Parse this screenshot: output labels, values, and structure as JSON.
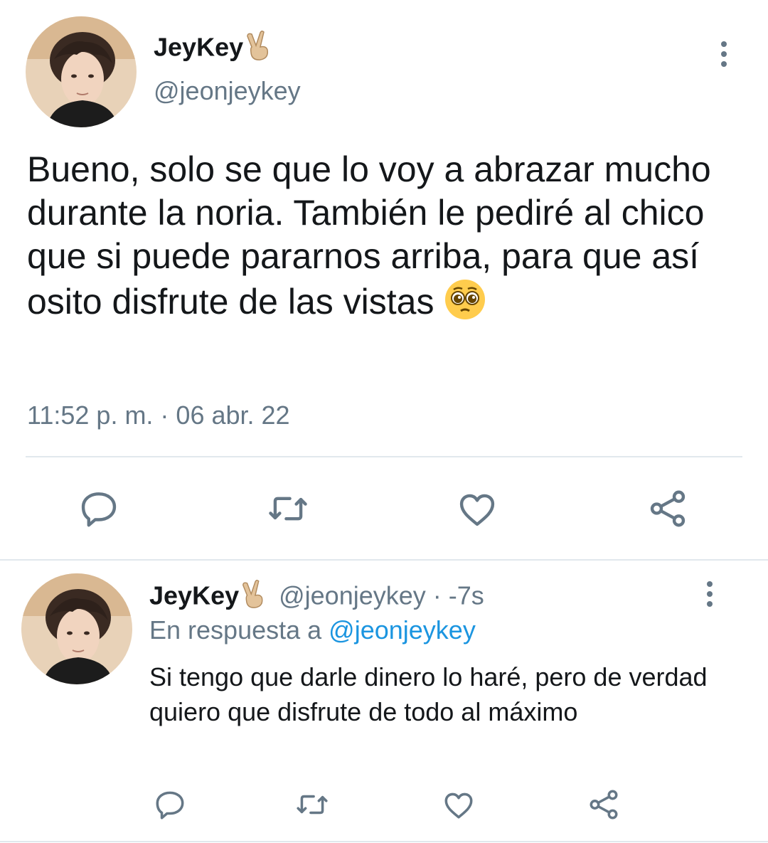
{
  "main_tweet": {
    "display_name": "JeyKey",
    "name_emoji": "victory-hand-emoji",
    "handle": "@jeonjeykey",
    "text": "Bueno, solo se que lo voy a abrazar mucho durante la noria. También le pediré al chico que si puede pararnos arriba, para que así osito disfrute de las vistas",
    "text_emoji": "pleading-face-emoji",
    "timestamp": "11:52 p. m. · 06 abr. 22"
  },
  "reply_tweet": {
    "display_name": "JeyKey",
    "name_emoji": "victory-hand-emoji",
    "handle_time": "@jeonjeykey · -7s",
    "reply_prefix": "En respuesta a",
    "reply_handle": "@jeonjeykey",
    "text": "Si tengo que darle dinero lo haré, pero de verdad quiero que disfrute de todo al máximo"
  },
  "actions": [
    "reply-icon",
    "retweet-icon",
    "like-icon",
    "share-icon"
  ],
  "colors": {
    "text": "#14171a",
    "secondary": "#657786",
    "link": "#1b95e0",
    "divider": "#e1e8ed",
    "icon": "#657786"
  }
}
